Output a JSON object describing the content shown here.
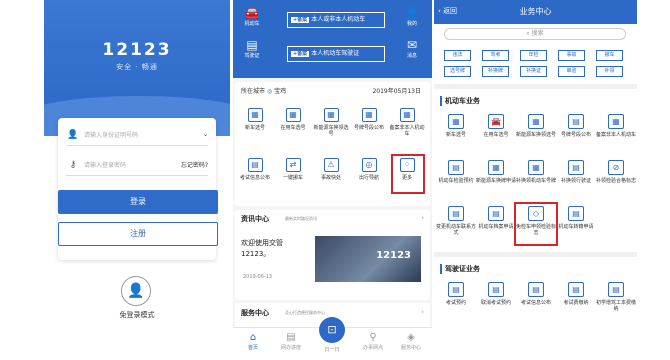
{
  "login": {
    "logo": "12123",
    "slogan": "安全 · 畅通",
    "id_placeholder": "请输入身份证明号码",
    "pwd_placeholder": "请输入登录密码",
    "forgot": "忘记密码?",
    "login_btn": "登录",
    "register_btn": "注册",
    "no_login": "免登录模式"
  },
  "home": {
    "top_icons": [
      {
        "label": "机动车",
        "glyph": "🚘"
      },
      {
        "label": "驾驶证",
        "glyph": "▤"
      },
      {
        "label": "我的",
        "glyph": "👤"
      },
      {
        "label": "消息",
        "glyph": "✉"
      }
    ],
    "banners": [
      {
        "tag": "+备案",
        "text": "本人或非本人机动车"
      },
      {
        "tag": "+备案",
        "text": "本人机动车驾驶证"
      }
    ],
    "city_label": "所在城市",
    "city": "宝鸡",
    "date": "2019年05月13日",
    "grid": [
      {
        "label": "新车选号",
        "glyph": "▦"
      },
      {
        "label": "在用车选号",
        "glyph": "▦"
      },
      {
        "label": "新能源车换领选号",
        "glyph": "▦"
      },
      {
        "label": "号牌号段公布",
        "glyph": "▦"
      },
      {
        "label": "备案非本人机动车",
        "glyph": "▦"
      },
      {
        "label": "考试信息公布",
        "glyph": "▤"
      },
      {
        "label": "一键挪车",
        "glyph": "⇄"
      },
      {
        "label": "事故快处",
        "glyph": "⚠"
      },
      {
        "label": "出行导航",
        "glyph": "◎"
      },
      {
        "label": "更多",
        "glyph": "⁘"
      }
    ],
    "news_title": "资讯中心",
    "news_sub": "最新实时路况资讯",
    "news_text": "欢迎使用交管12123。",
    "news_date": "2019-06-13",
    "news_img_text": "12123",
    "service_title": "服务中心",
    "service_sub": "及心打造便民服务中心",
    "tabs": [
      {
        "label": "首页",
        "glyph": "⌂"
      },
      {
        "label": "网办进度",
        "glyph": "▤"
      },
      {
        "label": "扫一扫",
        "glyph": "⊡"
      },
      {
        "label": "办事网点",
        "glyph": "⚲"
      },
      {
        "label": "服务中心",
        "glyph": "◈"
      }
    ]
  },
  "services": {
    "back": "返回",
    "title": "业务中心",
    "search_placeholder": "搜索",
    "chips_row1": [
      "违法",
      "驾考",
      "年检",
      "事故",
      "挪车"
    ],
    "chips_row2": [
      "选号牌",
      "补换牌",
      "补换证",
      "审验",
      "补领"
    ],
    "vehicle_section": "机动车业务",
    "vehicle_items": [
      {
        "label": "新车选号",
        "glyph": "▦"
      },
      {
        "label": "在用车选号",
        "glyph": "🚘"
      },
      {
        "label": "新能源车换领选号",
        "glyph": "▦"
      },
      {
        "label": "号牌号段公布",
        "glyph": "▤"
      },
      {
        "label": "备案非本人机动车",
        "glyph": "▦"
      },
      {
        "label": "机动车检验预约",
        "glyph": "▤"
      },
      {
        "label": "新能源车换牌申请",
        "glyph": "▦"
      },
      {
        "label": "补换领机动车号牌",
        "glyph": "▦"
      },
      {
        "label": "补换领行驶证",
        "glyph": "▤"
      },
      {
        "label": "补领检验合格标志",
        "glyph": "⊘"
      },
      {
        "label": "变更机动车联系方式",
        "glyph": "▤"
      },
      {
        "label": "机动车档案申请",
        "glyph": "▤"
      },
      {
        "label": "免检车申领检验标志",
        "glyph": "◇"
      },
      {
        "label": "机动车转籍申请",
        "glyph": "▤"
      }
    ],
    "license_section": "驾驶证业务",
    "license_items": [
      {
        "label": "考试预约",
        "glyph": "▤"
      },
      {
        "label": "取消考试预约",
        "glyph": "▤"
      },
      {
        "label": "考试信息公布",
        "glyph": "▤"
      },
      {
        "label": "考试费缴纳",
        "glyph": "▤"
      },
      {
        "label": "初学增驾工本费缴纳",
        "glyph": "▤"
      }
    ]
  }
}
